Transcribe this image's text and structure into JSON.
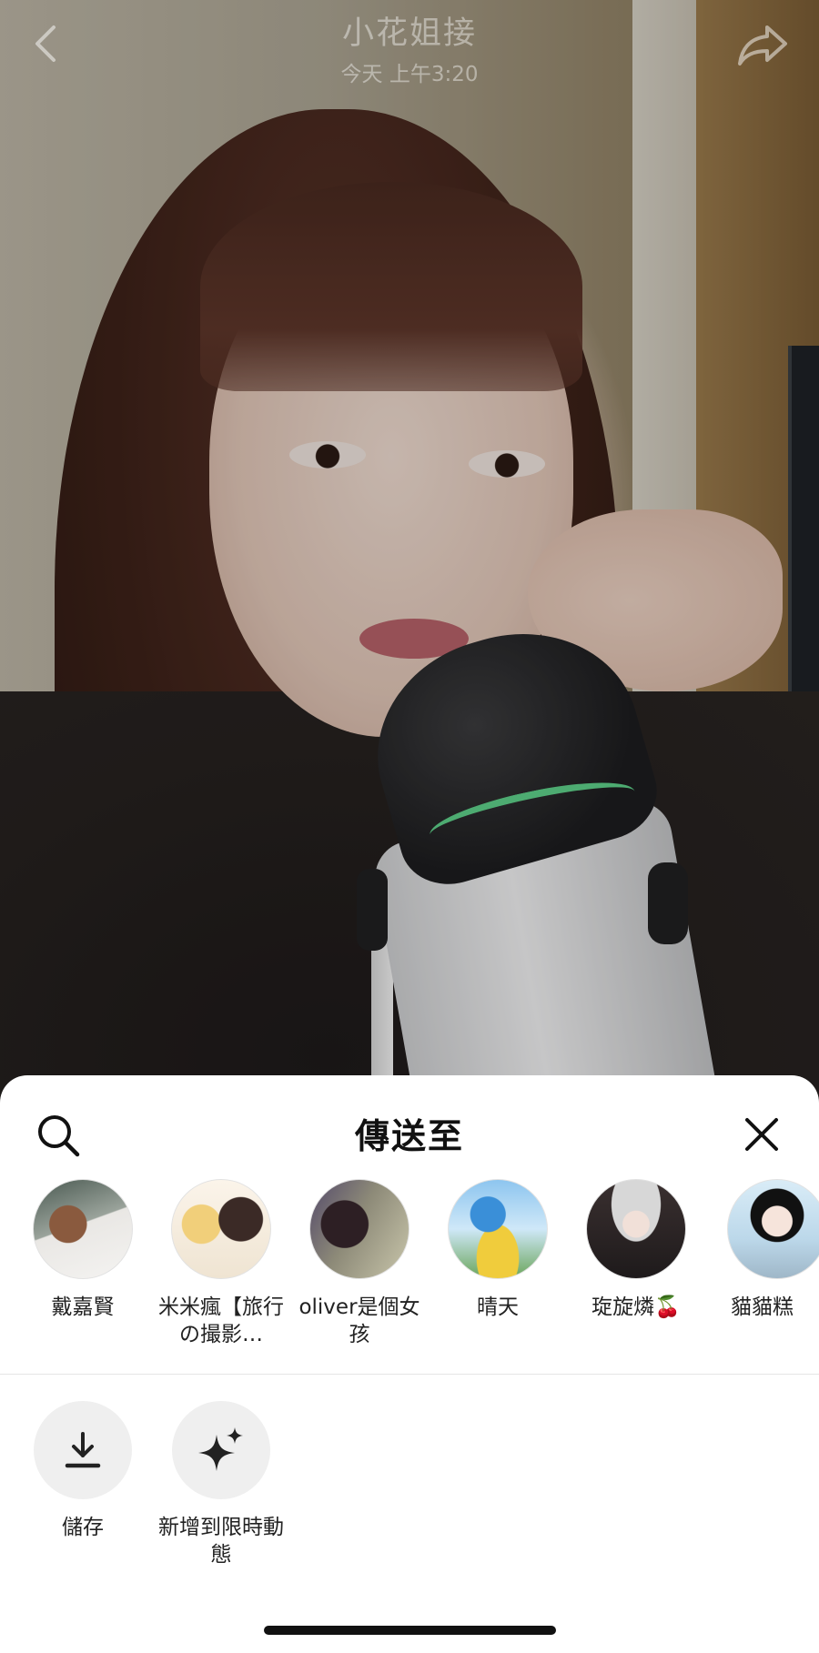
{
  "header": {
    "title": "小花姐接",
    "timestamp": "今天 上午3:20",
    "back_icon": "chevron-left-icon",
    "share_icon": "share-arrow-icon"
  },
  "sheet": {
    "title": "傳送至",
    "search_icon": "search-icon",
    "close_icon": "close-icon",
    "contacts": [
      {
        "name": "戴嘉賢"
      },
      {
        "name": "米米瘋【旅行の撮影…"
      },
      {
        "name": "oliver是個女孩"
      },
      {
        "name": "晴天"
      },
      {
        "name": "琁旋燐🍒"
      },
      {
        "name": "貓貓糕"
      }
    ],
    "actions": [
      {
        "label": "儲存",
        "icon": "download-icon"
      },
      {
        "label": "新增到限時動態",
        "icon": "sparkle-icon"
      }
    ]
  },
  "colors": {
    "sheet_background": "#ffffff",
    "action_circle": "#efefef",
    "text_primary": "#111111"
  }
}
